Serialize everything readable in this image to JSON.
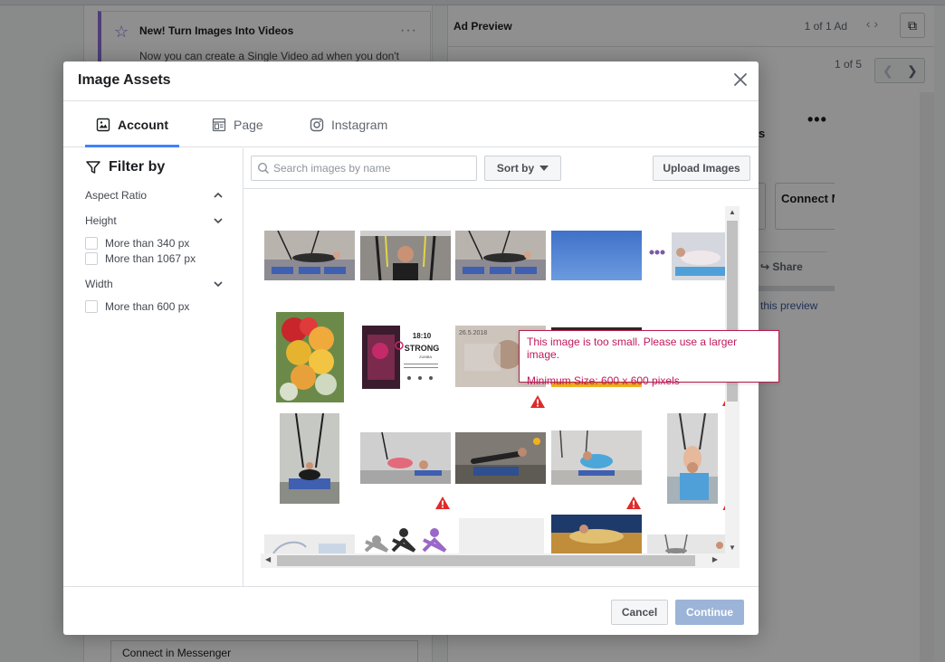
{
  "background": {
    "notice_title": "New! Turn Images Into Videos",
    "notice_body": "Now you can create a Single Video ad when you don't",
    "messenger_field": "Connect in Messenger",
    "preview_title": "Ad Preview",
    "preview_count": "1 of 1 Ad",
    "pager_text": "1 of 5",
    "ad_partial_label": "s",
    "connect_label": "Connect Messeng",
    "share_label": "Share",
    "preview_link": "this preview"
  },
  "modal": {
    "title": "Image Assets",
    "tabs": [
      {
        "label": "Account",
        "icon": "image-icon",
        "active": true
      },
      {
        "label": "Page",
        "icon": "page-icon",
        "active": false
      },
      {
        "label": "Instagram",
        "icon": "instagram-icon",
        "active": false
      }
    ],
    "filter": {
      "heading": "Filter by",
      "sections": [
        {
          "label": "Aspect Ratio",
          "expanded": true
        },
        {
          "label": "Height",
          "expanded": true,
          "options": [
            "More than 340 px",
            "More than 1067 px"
          ]
        },
        {
          "label": "Width",
          "expanded": true,
          "options": [
            "More than 600 px"
          ]
        }
      ]
    },
    "toolbar": {
      "search_placeholder": "Search images by name",
      "sort_label": "Sort by",
      "upload_label": "Upload Images"
    },
    "tooltip": {
      "line1": "This image is too small. Please use a larger image.",
      "line2": "Minimum Size: 600 x 600 pixels"
    },
    "footer": {
      "cancel_label": "Cancel",
      "continue_label": "Continue"
    },
    "poster_text": {
      "time": "18:10",
      "brand": "STRONG",
      "sub": "ZUMBA",
      "date": "26.5.2018"
    }
  },
  "colors": {
    "accent": "#4080ff",
    "warning": "#e02a2a",
    "tooltip_text": "#c2185b",
    "continue_disabled": "#9cb4d8"
  }
}
